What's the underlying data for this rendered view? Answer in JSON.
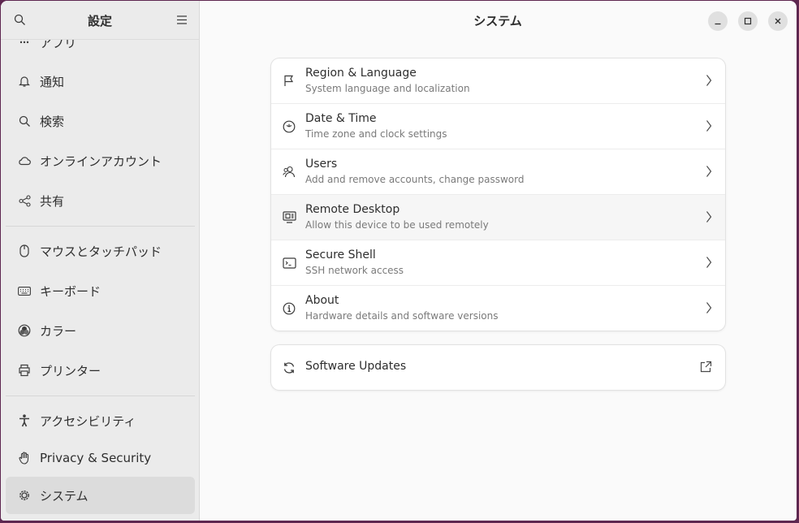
{
  "sidebar": {
    "title": "設定",
    "items": [
      {
        "label": "アプリ",
        "icon": "apps-icon"
      },
      {
        "label": "通知",
        "icon": "bell-icon"
      },
      {
        "label": "検索",
        "icon": "search-icon"
      },
      {
        "label": "オンラインアカウント",
        "icon": "cloud-icon"
      },
      {
        "label": "共有",
        "icon": "share-icon"
      },
      {
        "label": "マウスとタッチパッド",
        "icon": "mouse-icon"
      },
      {
        "label": "キーボード",
        "icon": "keyboard-icon"
      },
      {
        "label": "カラー",
        "icon": "color-icon"
      },
      {
        "label": "プリンター",
        "icon": "printer-icon"
      },
      {
        "label": "アクセシビリティ",
        "icon": "accessibility-icon"
      },
      {
        "label": "Privacy & Security",
        "icon": "hand-icon"
      },
      {
        "label": "システム",
        "icon": "system-gear-icon"
      }
    ]
  },
  "main": {
    "title": "システム",
    "rows": [
      {
        "title": "Region & Language",
        "subtitle": "System language and localization",
        "icon": "flag-icon"
      },
      {
        "title": "Date & Time",
        "subtitle": "Time zone and clock settings",
        "icon": "clock-icon"
      },
      {
        "title": "Users",
        "subtitle": "Add and remove accounts, change password",
        "icon": "users-icon"
      },
      {
        "title": "Remote Desktop",
        "subtitle": "Allow this device to be used remotely",
        "icon": "remote-desktop-icon"
      },
      {
        "title": "Secure Shell",
        "subtitle": "SSH network access",
        "icon": "terminal-icon"
      },
      {
        "title": "About",
        "subtitle": "Hardware details and software versions",
        "icon": "info-icon"
      }
    ],
    "updates": {
      "title": "Software Updates",
      "icon": "refresh-icon"
    }
  },
  "colors": {
    "accent": "#5e2750",
    "window_bg": "#fafafa",
    "sidebar_bg": "#ebebeb",
    "active_item": "#dcdcdc"
  }
}
